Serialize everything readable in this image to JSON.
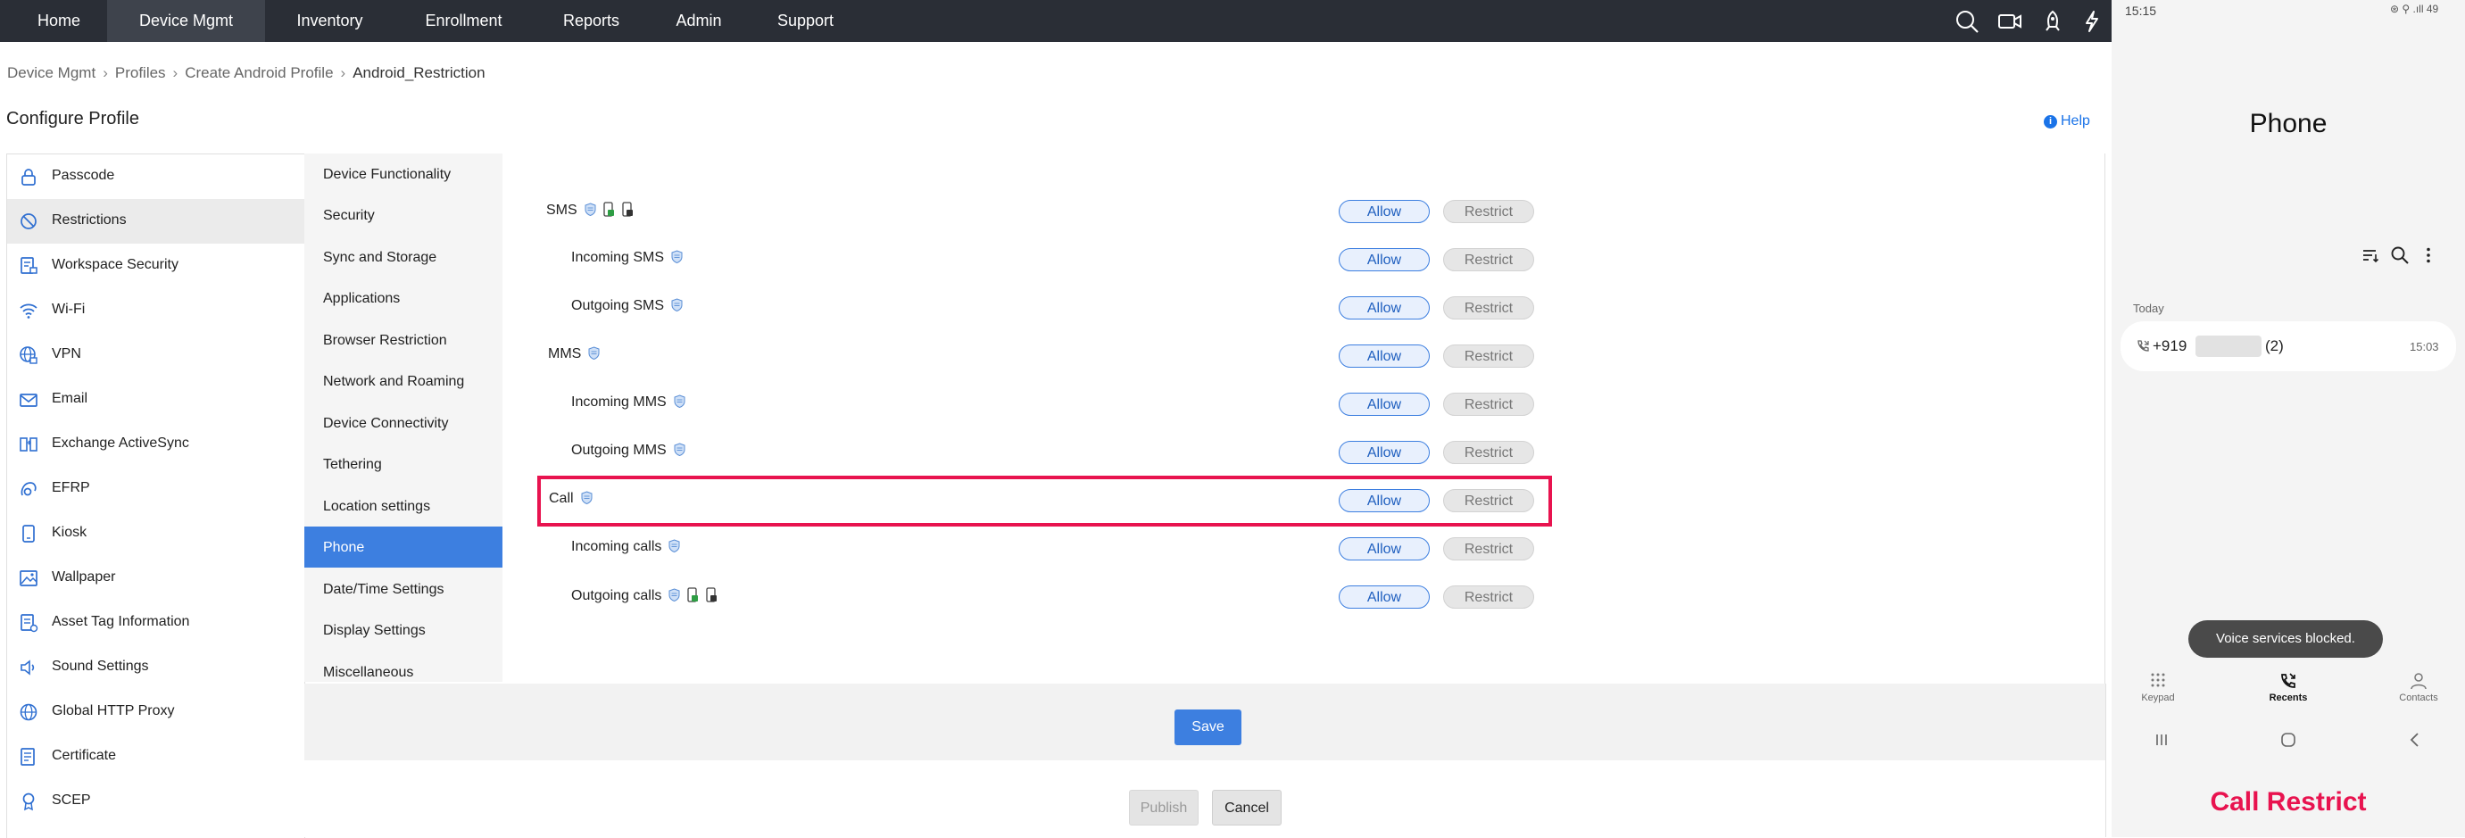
{
  "nav": {
    "items": [
      "Home",
      "Device Mgmt",
      "Inventory",
      "Enrollment",
      "Reports",
      "Admin",
      "Support"
    ],
    "active": "Device Mgmt",
    "icons": [
      "search-icon",
      "video-icon",
      "rocket-icon",
      "lightning-icon"
    ]
  },
  "breadcrumb": [
    "Device Mgmt",
    "Profiles",
    "Create Android Profile",
    "Android_Restriction"
  ],
  "page_title": "Configure Profile",
  "help": "Help",
  "left_panel": {
    "items": [
      {
        "label": "Passcode",
        "icon": "lock-icon"
      },
      {
        "label": "Restrictions",
        "icon": "block-icon",
        "active": true
      },
      {
        "label": "Workspace Security",
        "icon": "document-lock-icon"
      },
      {
        "label": "Wi-Fi",
        "icon": "wifi-icon"
      },
      {
        "label": "VPN",
        "icon": "globe-lock-icon"
      },
      {
        "label": "Email",
        "icon": "mail-icon"
      },
      {
        "label": "Exchange ActiveSync",
        "icon": "sync-icon"
      },
      {
        "label": "EFRP",
        "icon": "key-icon"
      },
      {
        "label": "Kiosk",
        "icon": "kiosk-icon"
      },
      {
        "label": "Wallpaper",
        "icon": "image-icon"
      },
      {
        "label": "Asset Tag Information",
        "icon": "tag-icon"
      },
      {
        "label": "Sound Settings",
        "icon": "speaker-icon"
      },
      {
        "label": "Global HTTP Proxy",
        "icon": "globe-icon"
      },
      {
        "label": "Certificate",
        "icon": "certificate-icon"
      },
      {
        "label": "SCEP",
        "icon": "badge-icon"
      }
    ]
  },
  "mid_panel": {
    "items": [
      "Device Functionality",
      "Security",
      "Sync and Storage",
      "Applications",
      "Browser Restriction",
      "Network and Roaming",
      "Device Connectivity",
      "Tethering",
      "Location settings",
      "Phone",
      "Date/Time Settings",
      "Display Settings",
      "Miscellaneous"
    ],
    "active": "Phone"
  },
  "settings": {
    "allow_label": "Allow",
    "restrict_label": "Restrict",
    "rows": [
      {
        "label": "SMS",
        "sub": false,
        "icons": [
          "shield-icon",
          "device-green-icon",
          "device-dark-icon"
        ],
        "value": "Allow"
      },
      {
        "label": "Incoming SMS",
        "sub": true,
        "icons": [
          "shield-icon"
        ],
        "value": "Allow"
      },
      {
        "label": "Outgoing SMS",
        "sub": true,
        "icons": [
          "shield-icon"
        ],
        "value": "Allow"
      },
      {
        "label": "MMS",
        "sub": false,
        "icons": [
          "shield-icon"
        ],
        "value": "Allow"
      },
      {
        "label": "Incoming MMS",
        "sub": true,
        "icons": [
          "shield-icon"
        ],
        "value": "Allow"
      },
      {
        "label": "Outgoing MMS",
        "sub": true,
        "icons": [
          "shield-icon"
        ],
        "value": "Allow"
      },
      {
        "label": "Call",
        "sub": false,
        "icons": [
          "shield-icon"
        ],
        "value": "Allow",
        "highlighted": true
      },
      {
        "label": "Incoming calls",
        "sub": true,
        "icons": [
          "shield-icon"
        ],
        "value": "Allow"
      },
      {
        "label": "Outgoing calls",
        "sub": true,
        "icons": [
          "shield-icon",
          "device-green-icon",
          "device-dark-icon"
        ],
        "value": "Allow"
      }
    ]
  },
  "buttons": {
    "save": "Save",
    "publish": "Publish",
    "cancel": "Cancel"
  },
  "phone": {
    "time": "15:15",
    "status": "⊛ ⚲ .ıll 49",
    "title": "Phone",
    "section": "Today",
    "call": {
      "number": "+919",
      "count": "(2)",
      "time": "15:03"
    },
    "toast": "Voice services blocked.",
    "tabs": [
      {
        "label": "Keypad",
        "icon": "keypad-icon"
      },
      {
        "label": "Recents",
        "icon": "recents-icon",
        "active": true
      },
      {
        "label": "Contacts",
        "icon": "contacts-icon"
      }
    ],
    "caption": "Call Restrict"
  },
  "colors": {
    "accent": "#3d7fe0",
    "highlight": "#e8134f",
    "nav_bg": "#2a2e36"
  }
}
